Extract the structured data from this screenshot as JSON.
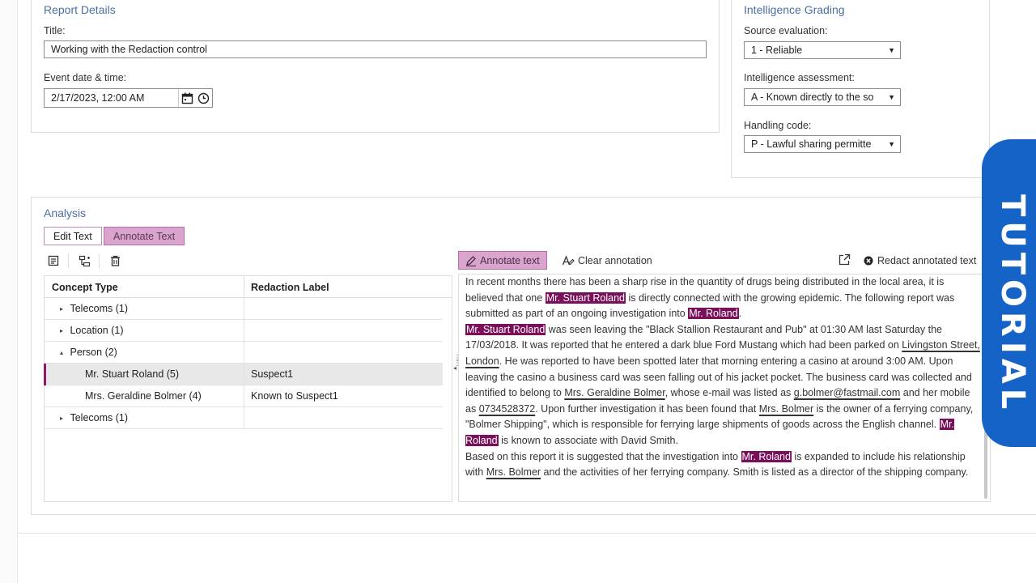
{
  "report_details": {
    "heading": "Report Details",
    "title_label": "Title:",
    "title_value": "Working with the Redaction control",
    "event_label": "Event date & time:",
    "event_value": "2/17/2023, 12:00 AM"
  },
  "grading": {
    "heading": "Intelligence Grading",
    "source_label": "Source evaluation:",
    "source_value": "1 - Reliable",
    "assessment_label": "Intelligence assessment:",
    "assessment_value": "A - Known directly to the so",
    "handling_label": "Handling code:",
    "handling_value": "P - Lawful sharing permitte"
  },
  "analysis": {
    "heading": "Analysis",
    "tab_edit": "Edit Text",
    "tab_annotate": "Annotate Text",
    "table_headers": {
      "concept": "Concept Type",
      "label": "Redaction Label"
    },
    "rows": [
      {
        "concept": "Telecoms (1)",
        "label": "",
        "expander": "▸",
        "level": 0
      },
      {
        "concept": "Location (1)",
        "label": "",
        "expander": "▸",
        "level": 0
      },
      {
        "concept": "Person (2)",
        "label": "",
        "expander": "▴",
        "level": 0
      },
      {
        "concept": "Mr. Stuart Roland (5)",
        "label": "Suspect1",
        "expander": "",
        "level": 1,
        "selected": true
      },
      {
        "concept": "Mrs. Geraldine Bolmer (4)",
        "label": "Known to Suspect1",
        "expander": "",
        "level": 1
      },
      {
        "concept": "Telecoms (1)",
        "label": "",
        "expander": "▸",
        "level": 0
      }
    ],
    "toolbar": {
      "annotate_text": "Annotate text",
      "clear_annotation": "Clear annotation",
      "redact_annotated": "Redact annotated text"
    },
    "body_text": [
      {
        "t": "In recent months there has been a sharp rise in the quantity of drugs being distributed in the local area, it is believed that one "
      },
      {
        "t": "Mr. Stuart Roland",
        "s": "hl"
      },
      {
        "t": " is directly connected with the growing epidemic. The following report was submitted as part of an ongoing investigation into "
      },
      {
        "t": "Mr. Roland",
        "s": "hl"
      },
      {
        "t": ". ",
        "br": true
      },
      {
        "t": "Mr. Stuart Roland",
        "s": "hl"
      },
      {
        "t": " was seen leaving the \"Black Stallion Restaurant and Pub\" at 01:30 AM last Saturday the 17/03/2018. It was reported that he entered a dark blue Ford Mustang which had been parked on "
      },
      {
        "t": "Livingston Street, London",
        "s": "ul"
      },
      {
        "t": ". He was reported to have been spotted later that morning entering a casino at around 3:00 AM. Upon leaving the casino a business card was seen falling out of his jacket pocket. The business card was collected and identified to belong to "
      },
      {
        "t": "Mrs. Geraldine Bolmer",
        "s": "ul"
      },
      {
        "t": ", whose e-mail was listed as "
      },
      {
        "t": "g.bolmer@fastmail.com",
        "s": "ul"
      },
      {
        "t": " and her mobile as "
      },
      {
        "t": "0734528372",
        "s": "ul"
      },
      {
        "t": ". Upon further investigation it has been found that "
      },
      {
        "t": "Mrs. Bolmer",
        "s": "ul"
      },
      {
        "t": " is the owner of a ferrying company, \"Bolmer Shipping\", which is responsible for ferrying large shipments of goods across the English channel. "
      },
      {
        "t": "Mr. Roland",
        "s": "hl"
      },
      {
        "t": " is known to associate with David Smith.",
        "br": true
      },
      {
        "t": "Based on this report it is suggested that the investigation into "
      },
      {
        "t": "Mr. Roland",
        "s": "hl"
      },
      {
        "t": " is expanded to include his relationship with "
      },
      {
        "t": "Mrs. Bolmer",
        "s": "ul"
      },
      {
        "t": " and the activities of her ferrying company. Smith is listed as a director of the shipping company."
      }
    ]
  },
  "overlay": {
    "banner": "TUTORIAL",
    "color": "#1663c7"
  },
  "colors": {
    "highlight": "#7a0f5a",
    "accent": "#d9a5cf",
    "heading": "#4a6fa5"
  }
}
